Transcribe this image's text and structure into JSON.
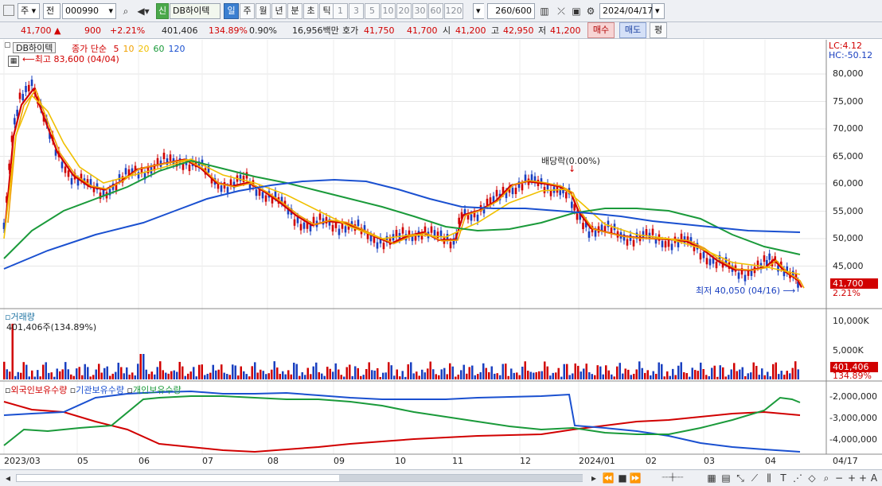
{
  "toolbar": {
    "view_mode": "주",
    "price_type": "전",
    "code": "000990",
    "badge": "신",
    "name": "DB하이텍",
    "periods": [
      "일",
      "주",
      "월",
      "년",
      "분",
      "초",
      "틱"
    ],
    "active_period": "일",
    "minutes": [
      "1",
      "3",
      "5",
      "10",
      "20",
      "30",
      "60",
      "120"
    ],
    "count": "260",
    "count_max": "/600",
    "date": "2024/04/17"
  },
  "quote": {
    "price": "41,700",
    "arrow": "▲",
    "change": "900",
    "change_pct": "+2.21%",
    "volume": "401,406",
    "vol_ratio": "134.89%",
    "turnover": "0.90%",
    "amount": "16,956백만",
    "bid_label": "호가",
    "ask": "41,750",
    "bid": "41,700",
    "open_label": "시",
    "open": "41,200",
    "high_label": "고",
    "high": "42,950",
    "low_label": "저",
    "low": "41,200",
    "buy": "매수",
    "sell": "매도",
    "avg": "평"
  },
  "main": {
    "ma_title": "종가 단순",
    "ma_periods": [
      "5",
      "10",
      "20",
      "60",
      "120"
    ],
    "ma_colors": [
      "#d10000",
      "#f0a000",
      "#f0c000",
      "#1a9a3a",
      "#1a50d0"
    ],
    "high_note": "최고 83,600 (04/04)",
    "low_note": "최저 40,050 (04/16)",
    "dividend": "배당락(0.00%)",
    "stock_tag": "DB하이텍",
    "lc": "LC:4.12",
    "hc": "HC:-50.12",
    "price_tag": "41,700",
    "pct_tag": "2.21%",
    "yticks": [
      "80,000",
      "75,000",
      "70,000",
      "65,000",
      "60,000",
      "55,000",
      "50,000",
      "45,000"
    ]
  },
  "volume": {
    "title": "거래량",
    "info": "401,406주(134.89%)",
    "yticks": [
      "10,000K",
      "5,000K"
    ],
    "tag": "401,406",
    "tag_pct": "134.89%"
  },
  "holdings": {
    "labels": [
      "외국인보유수량",
      "기관보유수량",
      "개인보유수량"
    ],
    "yticks": [
      "-2,000,000",
      "-3,000,000",
      "-4,000,000"
    ]
  },
  "xaxis": [
    "2023/03",
    "05",
    "06",
    "07",
    "08",
    "09",
    "10",
    "11",
    "12",
    "2024/01",
    "02",
    "03",
    "04",
    "04/17"
  ]
}
